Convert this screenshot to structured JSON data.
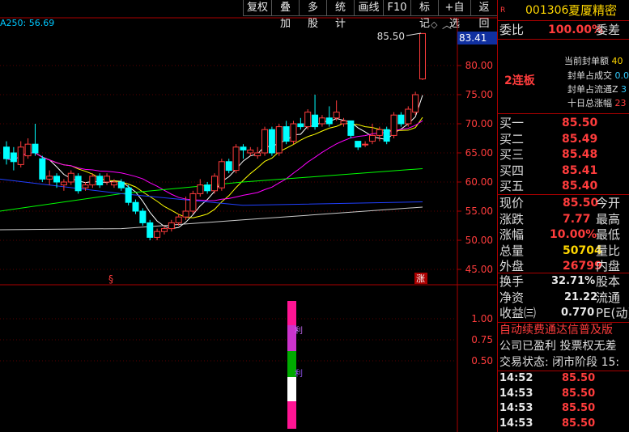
{
  "toolbar": {
    "buttons": [
      "复权",
      "叠加",
      "多股",
      "统计",
      "画线",
      "F10",
      "标记",
      "+自选",
      "返回"
    ]
  },
  "chart": {
    "ma_label": "A250: 56.69",
    "current_price_box": "83.41",
    "high_marker": "85.50",
    "y_ticks": [
      "80.00",
      "75.00",
      "70.00",
      "65.00",
      "60.00",
      "55.00",
      "50.00",
      "45.00"
    ],
    "sub_y_ticks": [
      "1.00",
      "0.75",
      "0.50"
    ],
    "bottom_marks": [
      "§",
      "涨"
    ],
    "bar_marks": [
      "利",
      "利"
    ]
  },
  "stock": {
    "badge": "R",
    "code": "001306",
    "name": "夏厦精密"
  },
  "weibi": {
    "label": "委比",
    "value": "100.00%",
    "label2": "委差"
  },
  "board": {
    "streak": "2连板",
    "lines": [
      {
        "label": "当前封单额",
        "value": "40"
      },
      {
        "label": "封单占成交",
        "value": "0.0"
      },
      {
        "label": "封单占流通Z",
        "value": "3"
      },
      {
        "label": "十日总涨幅",
        "value": "23"
      }
    ]
  },
  "bids": [
    {
      "label": "买一",
      "price": "85.50"
    },
    {
      "label": "买二",
      "price": "85.49"
    },
    {
      "label": "买三",
      "price": "85.48"
    },
    {
      "label": "买四",
      "price": "85.41"
    },
    {
      "label": "买五",
      "price": "85.40"
    }
  ],
  "quote": [
    {
      "label": "现价",
      "value": "85.50",
      "label2": "今开",
      "color": "#ff3c3c"
    },
    {
      "label": "涨跌",
      "value": "7.77",
      "label2": "最高",
      "color": "#ff3c3c"
    },
    {
      "label": "涨幅",
      "value": "10.00%",
      "label2": "最低",
      "color": "#ff3c3c"
    },
    {
      "label": "总量",
      "value": "50704",
      "label2": "量比",
      "color": "#ffd700"
    },
    {
      "label": "外盘",
      "value": "26799",
      "label2": "内盘",
      "color": "#ff3c3c"
    }
  ],
  "fund": [
    {
      "label": "换手",
      "value": "32.71%",
      "label2": "股本"
    },
    {
      "label": "净资",
      "value": "21.22",
      "label2": "流通"
    },
    {
      "label": "收益㈢",
      "value": "0.770",
      "label2": "PE(动)"
    }
  ],
  "notices": [
    "自动续费通达信普及版",
    "公司已盈利 投票权无差",
    "交易状态: 闭市阶段 15:"
  ],
  "ticks": [
    {
      "time": "14:52",
      "price": "85.50"
    },
    {
      "time": "14:53",
      "price": "85.50"
    },
    {
      "time": "14:53",
      "price": "85.50"
    },
    {
      "time": "14:53",
      "price": "85.50"
    }
  ],
  "colors": {
    "up": "#ff3c3c",
    "down": "#00ffff",
    "ma5": "#ffffff",
    "ma10": "#ffff00",
    "ma20": "#ff00ff",
    "ma60": "#00ff00",
    "ma120": "#2040ff",
    "ma250": "#cccccc"
  }
}
